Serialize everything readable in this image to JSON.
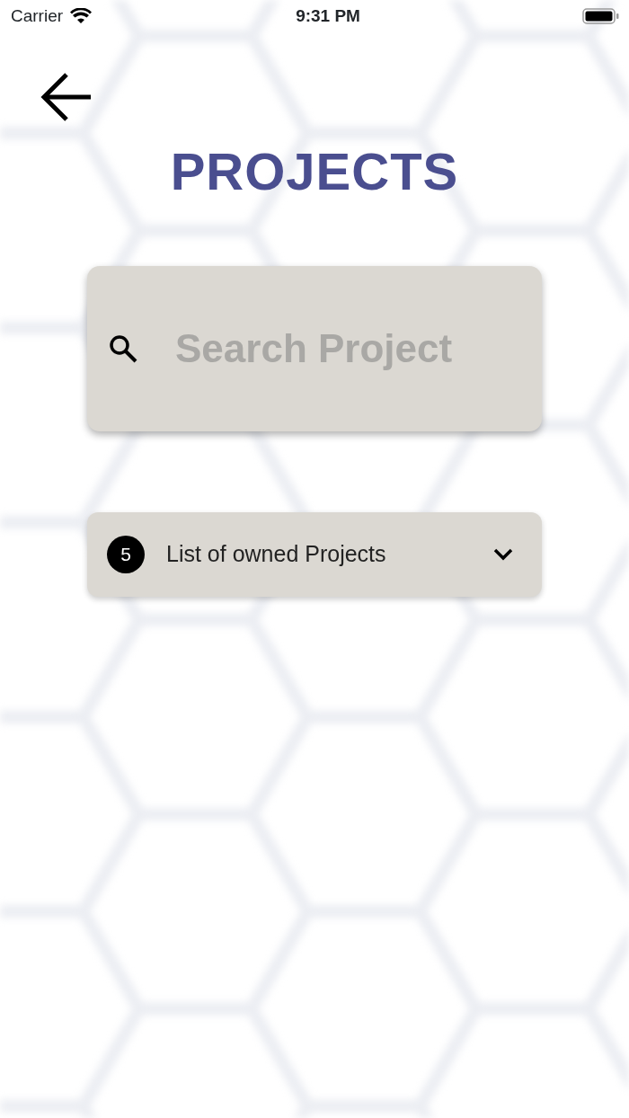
{
  "status_bar": {
    "carrier": "Carrier",
    "time": "9:31 PM"
  },
  "title": "PROJECTS",
  "search": {
    "placeholder": "Search Project"
  },
  "projects_panel": {
    "count": "5",
    "label": "List of owned Projects",
    "expanded": false
  }
}
